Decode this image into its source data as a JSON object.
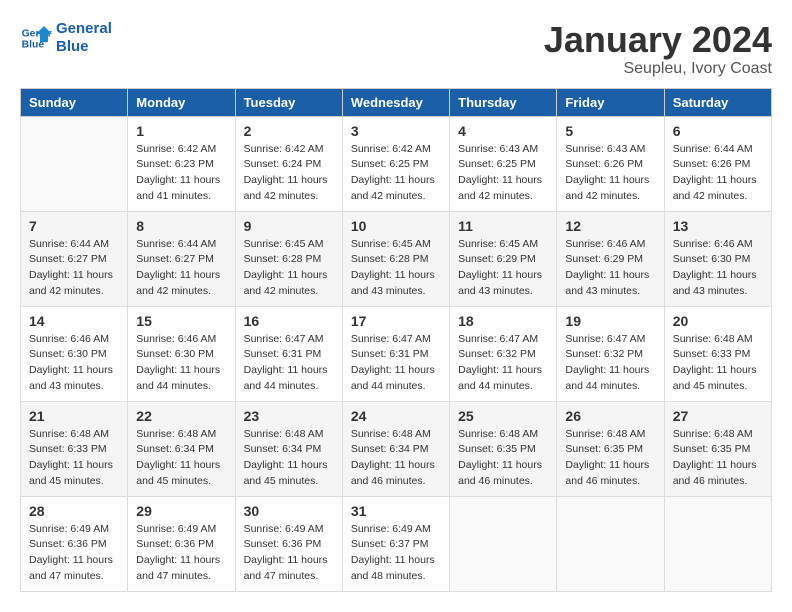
{
  "logo": {
    "line1": "General",
    "line2": "Blue"
  },
  "title": "January 2024",
  "subtitle": "Seupleu, Ivory Coast",
  "days_of_week": [
    "Sunday",
    "Monday",
    "Tuesday",
    "Wednesday",
    "Thursday",
    "Friday",
    "Saturday"
  ],
  "weeks": [
    [
      {
        "day": "",
        "info": ""
      },
      {
        "day": "1",
        "info": "Sunrise: 6:42 AM\nSunset: 6:23 PM\nDaylight: 11 hours\nand 41 minutes."
      },
      {
        "day": "2",
        "info": "Sunrise: 6:42 AM\nSunset: 6:24 PM\nDaylight: 11 hours\nand 42 minutes."
      },
      {
        "day": "3",
        "info": "Sunrise: 6:42 AM\nSunset: 6:25 PM\nDaylight: 11 hours\nand 42 minutes."
      },
      {
        "day": "4",
        "info": "Sunrise: 6:43 AM\nSunset: 6:25 PM\nDaylight: 11 hours\nand 42 minutes."
      },
      {
        "day": "5",
        "info": "Sunrise: 6:43 AM\nSunset: 6:26 PM\nDaylight: 11 hours\nand 42 minutes."
      },
      {
        "day": "6",
        "info": "Sunrise: 6:44 AM\nSunset: 6:26 PM\nDaylight: 11 hours\nand 42 minutes."
      }
    ],
    [
      {
        "day": "7",
        "info": "Sunrise: 6:44 AM\nSunset: 6:27 PM\nDaylight: 11 hours\nand 42 minutes."
      },
      {
        "day": "8",
        "info": "Sunrise: 6:44 AM\nSunset: 6:27 PM\nDaylight: 11 hours\nand 42 minutes."
      },
      {
        "day": "9",
        "info": "Sunrise: 6:45 AM\nSunset: 6:28 PM\nDaylight: 11 hours\nand 42 minutes."
      },
      {
        "day": "10",
        "info": "Sunrise: 6:45 AM\nSunset: 6:28 PM\nDaylight: 11 hours\nand 43 minutes."
      },
      {
        "day": "11",
        "info": "Sunrise: 6:45 AM\nSunset: 6:29 PM\nDaylight: 11 hours\nand 43 minutes."
      },
      {
        "day": "12",
        "info": "Sunrise: 6:46 AM\nSunset: 6:29 PM\nDaylight: 11 hours\nand 43 minutes."
      },
      {
        "day": "13",
        "info": "Sunrise: 6:46 AM\nSunset: 6:30 PM\nDaylight: 11 hours\nand 43 minutes."
      }
    ],
    [
      {
        "day": "14",
        "info": "Sunrise: 6:46 AM\nSunset: 6:30 PM\nDaylight: 11 hours\nand 43 minutes."
      },
      {
        "day": "15",
        "info": "Sunrise: 6:46 AM\nSunset: 6:30 PM\nDaylight: 11 hours\nand 44 minutes."
      },
      {
        "day": "16",
        "info": "Sunrise: 6:47 AM\nSunset: 6:31 PM\nDaylight: 11 hours\nand 44 minutes."
      },
      {
        "day": "17",
        "info": "Sunrise: 6:47 AM\nSunset: 6:31 PM\nDaylight: 11 hours\nand 44 minutes."
      },
      {
        "day": "18",
        "info": "Sunrise: 6:47 AM\nSunset: 6:32 PM\nDaylight: 11 hours\nand 44 minutes."
      },
      {
        "day": "19",
        "info": "Sunrise: 6:47 AM\nSunset: 6:32 PM\nDaylight: 11 hours\nand 44 minutes."
      },
      {
        "day": "20",
        "info": "Sunrise: 6:48 AM\nSunset: 6:33 PM\nDaylight: 11 hours\nand 45 minutes."
      }
    ],
    [
      {
        "day": "21",
        "info": "Sunrise: 6:48 AM\nSunset: 6:33 PM\nDaylight: 11 hours\nand 45 minutes."
      },
      {
        "day": "22",
        "info": "Sunrise: 6:48 AM\nSunset: 6:34 PM\nDaylight: 11 hours\nand 45 minutes."
      },
      {
        "day": "23",
        "info": "Sunrise: 6:48 AM\nSunset: 6:34 PM\nDaylight: 11 hours\nand 45 minutes."
      },
      {
        "day": "24",
        "info": "Sunrise: 6:48 AM\nSunset: 6:34 PM\nDaylight: 11 hours\nand 46 minutes."
      },
      {
        "day": "25",
        "info": "Sunrise: 6:48 AM\nSunset: 6:35 PM\nDaylight: 11 hours\nand 46 minutes."
      },
      {
        "day": "26",
        "info": "Sunrise: 6:48 AM\nSunset: 6:35 PM\nDaylight: 11 hours\nand 46 minutes."
      },
      {
        "day": "27",
        "info": "Sunrise: 6:48 AM\nSunset: 6:35 PM\nDaylight: 11 hours\nand 46 minutes."
      }
    ],
    [
      {
        "day": "28",
        "info": "Sunrise: 6:49 AM\nSunset: 6:36 PM\nDaylight: 11 hours\nand 47 minutes."
      },
      {
        "day": "29",
        "info": "Sunrise: 6:49 AM\nSunset: 6:36 PM\nDaylight: 11 hours\nand 47 minutes."
      },
      {
        "day": "30",
        "info": "Sunrise: 6:49 AM\nSunset: 6:36 PM\nDaylight: 11 hours\nand 47 minutes."
      },
      {
        "day": "31",
        "info": "Sunrise: 6:49 AM\nSunset: 6:37 PM\nDaylight: 11 hours\nand 48 minutes."
      },
      {
        "day": "",
        "info": ""
      },
      {
        "day": "",
        "info": ""
      },
      {
        "day": "",
        "info": ""
      }
    ]
  ]
}
